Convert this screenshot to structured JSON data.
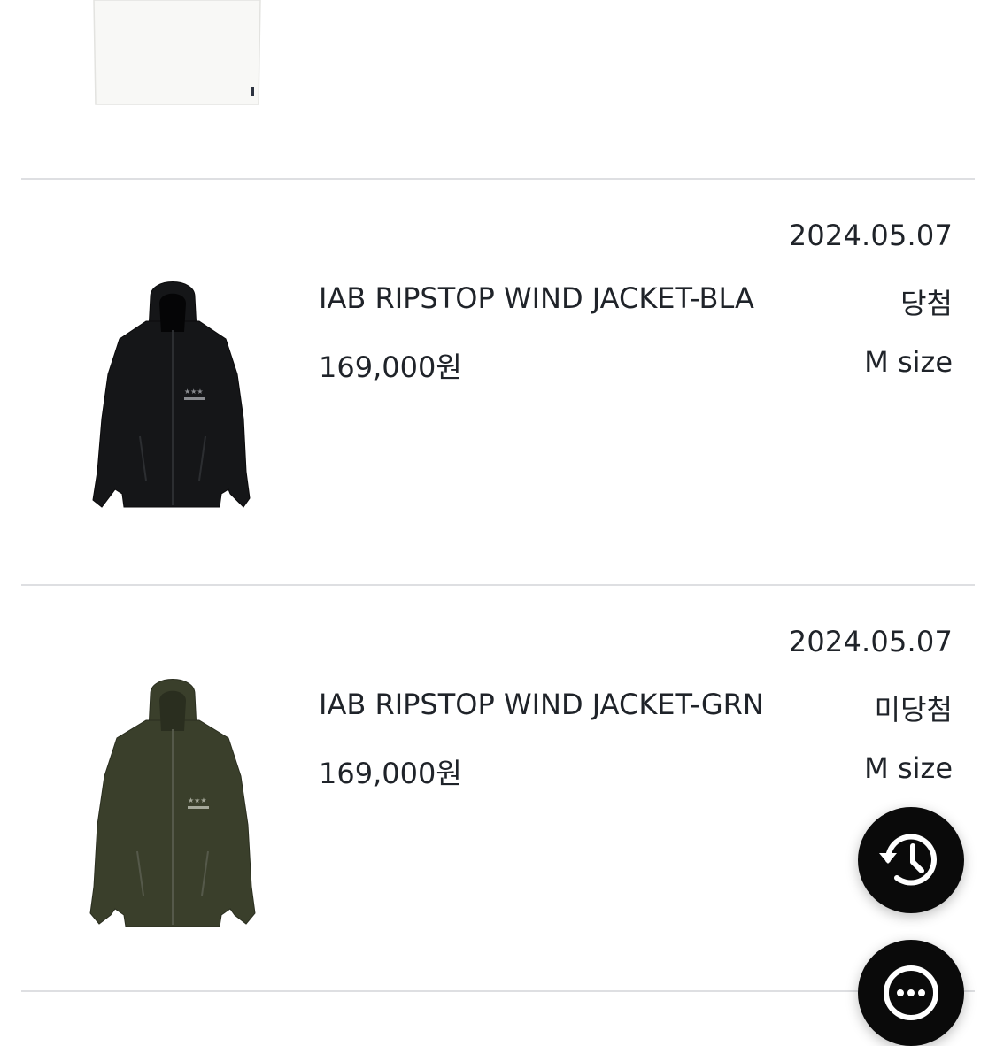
{
  "items": [
    {
      "date": "2024.05.07",
      "name": "IAB RIPSTOP WIND JACKET-BLA",
      "status": "당첨",
      "price": "169,000원",
      "size": "M size",
      "color": "#151618"
    },
    {
      "date": "2024.05.07",
      "name": "IAB RIPSTOP WIND JACKET-GRN",
      "status": "미당첨",
      "price": "169,000원",
      "size": "M size",
      "color": "#3a3f2b"
    }
  ],
  "fabs": {
    "recent_icon": "history-icon",
    "more_icon": "more-dots-icon"
  }
}
